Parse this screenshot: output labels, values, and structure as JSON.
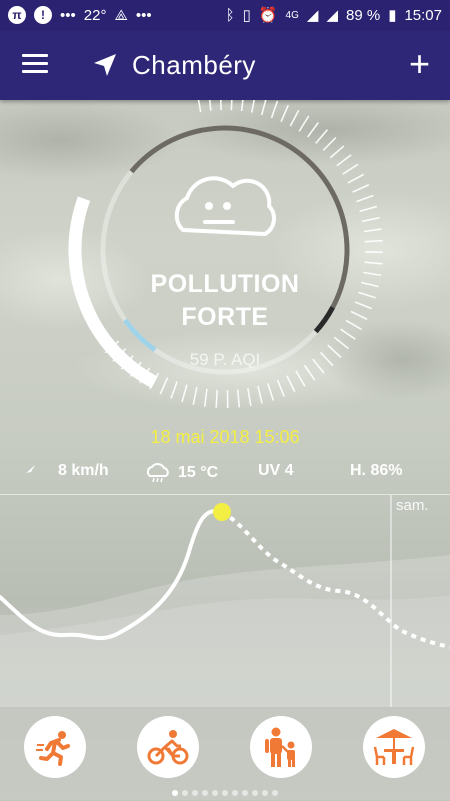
{
  "status_bar": {
    "temperature": "22°",
    "battery": "89 %",
    "time": "15:07",
    "network": "4G"
  },
  "app_bar": {
    "city": "Chambéry",
    "add_label": "+"
  },
  "gauge": {
    "pollution_line1": "POLLUTION",
    "pollution_line2": "FORTE",
    "aqi_text": "59 P. AQI",
    "aqi_value": 59,
    "face_icon": "cloud-face-icon"
  },
  "timestamp": "18 mai 2018 15:06",
  "stats": {
    "wind": "8 km/h",
    "temperature": "15 °C",
    "uv": "UV 4",
    "humidity": "H. 86%"
  },
  "forecast": {
    "day_label": "sam."
  },
  "activities": [
    {
      "name": "running",
      "icon": "runner-icon"
    },
    {
      "name": "cycling",
      "icon": "cyclist-icon"
    },
    {
      "name": "family",
      "icon": "family-icon"
    },
    {
      "name": "terrace",
      "icon": "terrace-icon"
    }
  ],
  "pager": {
    "count": 11,
    "active": 0
  },
  "colors": {
    "primary": "#2e2677",
    "accent_yellow": "#f3ee43",
    "activity_orange": "#f07a35"
  }
}
